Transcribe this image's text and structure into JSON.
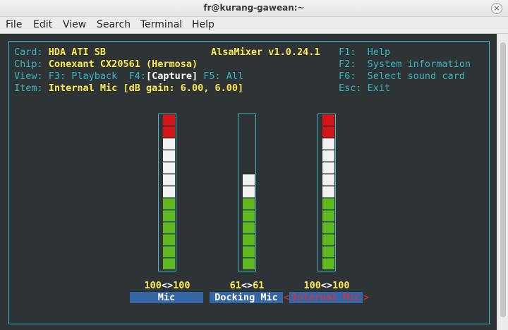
{
  "window": {
    "title": "fr@kurang-gawean:~",
    "close_glyph": "×"
  },
  "menu": [
    "File",
    "Edit",
    "View",
    "Search",
    "Terminal",
    "Help"
  ],
  "alsamixer": {
    "title": "AlsaMixer v1.0.24.1",
    "info": {
      "card_key": "Card:",
      "card_value": "HDA ATI SB",
      "chip_key": "Chip:",
      "chip_value": "Conexant CX20561 (Hermosa)",
      "view_key": "View:",
      "view_f3": "F3: Playback",
      "view_f4_key": "F4:",
      "view_f4_value": "[Capture]",
      "view_f5": "F5: All",
      "item_key": "Item:",
      "item_value": "Internal Mic [dB gain: 6.00, 6.00]"
    },
    "keys": [
      {
        "key": "F1:",
        "desc": "Help"
      },
      {
        "key": "F2:",
        "desc": "System information"
      },
      {
        "key": "F6:",
        "desc": "Select sound card"
      },
      {
        "key": "Esc:",
        "desc": "Exit"
      }
    ],
    "controls": [
      {
        "name": "Mic",
        "left": "100",
        "right": "100",
        "level": 1.0,
        "selected": false
      },
      {
        "name": "Docking Mic",
        "left": "61",
        "right": "61",
        "level": 0.61,
        "selected": false
      },
      {
        "name": "Internal Mic",
        "left": "100",
        "right": "100",
        "level": 1.0,
        "selected": true
      }
    ],
    "arrows": "<>",
    "sel_left": "<",
    "sel_right": ">"
  },
  "colors": {
    "background": "#2e3436",
    "border": "#3bbcc7",
    "label": "#fce94f",
    "key": "#34b6c0",
    "bar_green": "#5fb81f",
    "bar_white": "#f2f2f2",
    "bar_red": "#d41616",
    "selected": "#ef2929"
  }
}
